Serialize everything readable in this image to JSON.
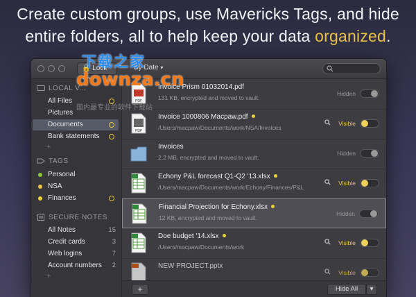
{
  "headline": {
    "line1": "Create custom groups, use Mavericks Tags, and hide",
    "line2_prefix": "entire folders, all to help keep your data ",
    "line2_accent": "organized",
    "line2_suffix": "."
  },
  "titlebar": {
    "lock_button": "Lock App",
    "sort_button": "By Date"
  },
  "sidebar": {
    "local_header": "LOCAL V...",
    "local_items": [
      {
        "label": "All Files",
        "ring": true
      },
      {
        "label": "Pictures",
        "ring": false
      },
      {
        "label": "Documents",
        "ring": true,
        "selected": true
      },
      {
        "label": "Bank statements",
        "ring": true
      }
    ],
    "tags_header": "TAGS",
    "tags": [
      {
        "label": "Personal",
        "color": "#8bc43f"
      },
      {
        "label": "NSA",
        "color": "#e9c24a"
      },
      {
        "label": "Finances",
        "color": "#e9d23a",
        "ring": true
      }
    ],
    "notes_header": "SECURE NOTES",
    "notes": [
      {
        "label": "All Notes",
        "count": "15"
      },
      {
        "label": "Credit cards",
        "count": "3"
      },
      {
        "label": "Web logins",
        "count": "7"
      },
      {
        "label": "Account numbers",
        "count": "2"
      }
    ],
    "add_symbol": "+"
  },
  "files": [
    {
      "name": "Invoice Prism 01032014.pdf",
      "sub": "131 KB, encrypted and moved to vault.",
      "status": "Hidden",
      "visible": false,
      "tag": false,
      "icon": "pdf-icon"
    },
    {
      "name": "Invoice 1000806 Macpaw.pdf",
      "sub": "/Users/macpaw/Documents/work/NSA/Invoices",
      "status": "Visible",
      "visible": true,
      "tag": true,
      "icon": "pdf-icon"
    },
    {
      "name": "Invoices",
      "sub": "2.2 MB, encrypted and moved to vault.",
      "status": "Hidden",
      "visible": false,
      "tag": false,
      "icon": "folder-icon"
    },
    {
      "name": "Echony P&L forecast Q1-Q2 '13.xlsx",
      "sub": "/Users/macpaw/Documents/work/Echony/Finances/P&L",
      "status": "Visible",
      "visible": true,
      "tag": true,
      "icon": "xlsx-icon"
    },
    {
      "name": "Financial Projection for Echony.xlsx",
      "sub": "12 KB, encrypted and moved to vault.",
      "status": "Hidden",
      "visible": false,
      "tag": true,
      "icon": "xlsx-icon",
      "selected": true
    },
    {
      "name": "Doe budget '14.xlsx",
      "sub": "/Users/macpaw/Documents/work",
      "status": "Visible",
      "visible": true,
      "tag": true,
      "icon": "xlsx-icon"
    },
    {
      "name": "NEW PROJECT.pptx",
      "sub": "",
      "status": "Visible",
      "visible": true,
      "tag": false,
      "icon": "pptx-icon"
    }
  ],
  "bottombar": {
    "add_label": "+",
    "hide_all_label": "Hide All",
    "menu_symbol": "▾"
  },
  "watermark": {
    "cn": "下载之家",
    "url": "downza.cn",
    "sub": "国内最专业的软件下载站"
  },
  "colors": {
    "accent": "#e9c24a",
    "tag_yellow": "#e9d23a"
  }
}
